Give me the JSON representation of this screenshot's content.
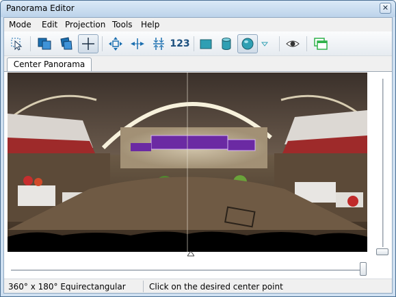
{
  "window": {
    "title": "Panorama Editor",
    "close_label": "✕"
  },
  "menu": [
    {
      "label": "Mode"
    },
    {
      "label": "Edit"
    },
    {
      "label": "Projection"
    },
    {
      "label": "Tools"
    },
    {
      "label": "Help"
    }
  ],
  "toolbar": {
    "tools": [
      {
        "name": "select-icon"
      },
      {
        "name": "move-images-icon"
      },
      {
        "name": "rotate-images-icon"
      },
      {
        "name": "center-point-icon",
        "active": true
      },
      {
        "name": "fit-both-icon"
      },
      {
        "name": "fit-horizontal-icon"
      },
      {
        "name": "fit-vertical-icon"
      },
      {
        "name": "numbers-icon",
        "label": "123"
      },
      {
        "name": "rectilinear-icon"
      },
      {
        "name": "cylindrical-icon"
      },
      {
        "name": "equirectangular-icon",
        "active": true
      },
      {
        "name": "dropdown-arrow-icon"
      },
      {
        "name": "preview-eye-icon"
      },
      {
        "name": "layers-icon"
      }
    ],
    "colors": {
      "accent": "#1b6fb0",
      "teal": "#2f9fb3",
      "green": "#2fb24a"
    }
  },
  "tabs": [
    {
      "label": "Center Panorama"
    }
  ],
  "status": {
    "projection": "360° x 180° Equirectangular",
    "message": "Click on the desired center point"
  }
}
